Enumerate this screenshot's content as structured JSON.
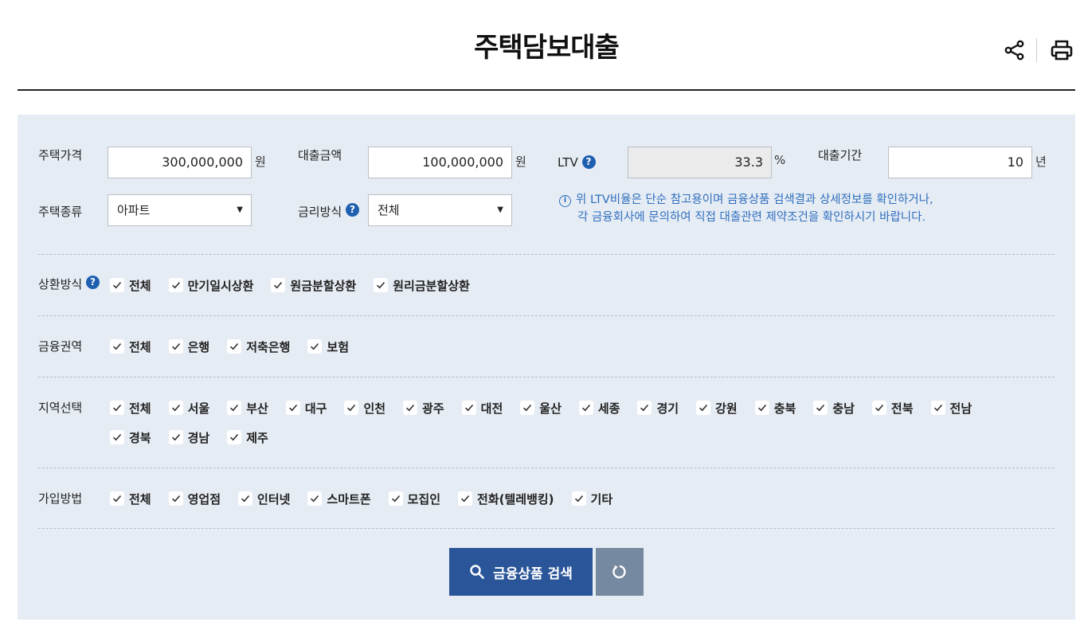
{
  "header": {
    "title": "주택담보대출",
    "share_icon": "share-icon",
    "print_icon": "print-icon"
  },
  "form": {
    "house_price": {
      "label": "주택가격",
      "value": "300,000,000",
      "unit": "원"
    },
    "loan_amount": {
      "label": "대출금액",
      "value": "100,000,000",
      "unit": "원"
    },
    "ltv": {
      "label": "LTV",
      "value": "33.3",
      "unit": "%"
    },
    "loan_period": {
      "label": "대출기간",
      "value": "10",
      "unit": "년"
    },
    "house_type": {
      "label": "주택종류",
      "selected": "아파트"
    },
    "rate_type": {
      "label": "금리방식",
      "selected": "전체"
    },
    "help_glyph": "?"
  },
  "notice": {
    "line1": "위 LTV비율은 단순 참고용이며 금융상품 검색결과 상세정보를 확인하거나,",
    "line2": "각 금융회사에 문의하여 직접 대출관련 제약조건을 확인하시기 바랍니다."
  },
  "groups": {
    "repayment": {
      "label": "상환방식",
      "options": [
        "전체",
        "만기일시상환",
        "원금분할상환",
        "원리금분할상환"
      ]
    },
    "sector": {
      "label": "금융권역",
      "options": [
        "전체",
        "은행",
        "저축은행",
        "보험"
      ]
    },
    "region": {
      "label": "지역선택",
      "options": [
        "전체",
        "서울",
        "부산",
        "대구",
        "인천",
        "광주",
        "대전",
        "울산",
        "세종",
        "경기",
        "강원",
        "충북",
        "충남",
        "전북",
        "전남",
        "경북",
        "경남",
        "제주"
      ]
    },
    "join": {
      "label": "가입방법",
      "options": [
        "전체",
        "영업점",
        "인터넷",
        "스마트폰",
        "모집인",
        "전화(텔레뱅킹)",
        "기타"
      ]
    }
  },
  "buttons": {
    "search_label": "금융상품 검색",
    "reset_icon": "refresh-icon"
  },
  "colors": {
    "accent": "#2a5599",
    "panel_bg": "#e6ecf4",
    "notice": "#2f6fbe",
    "help": "#1f5fb0"
  }
}
